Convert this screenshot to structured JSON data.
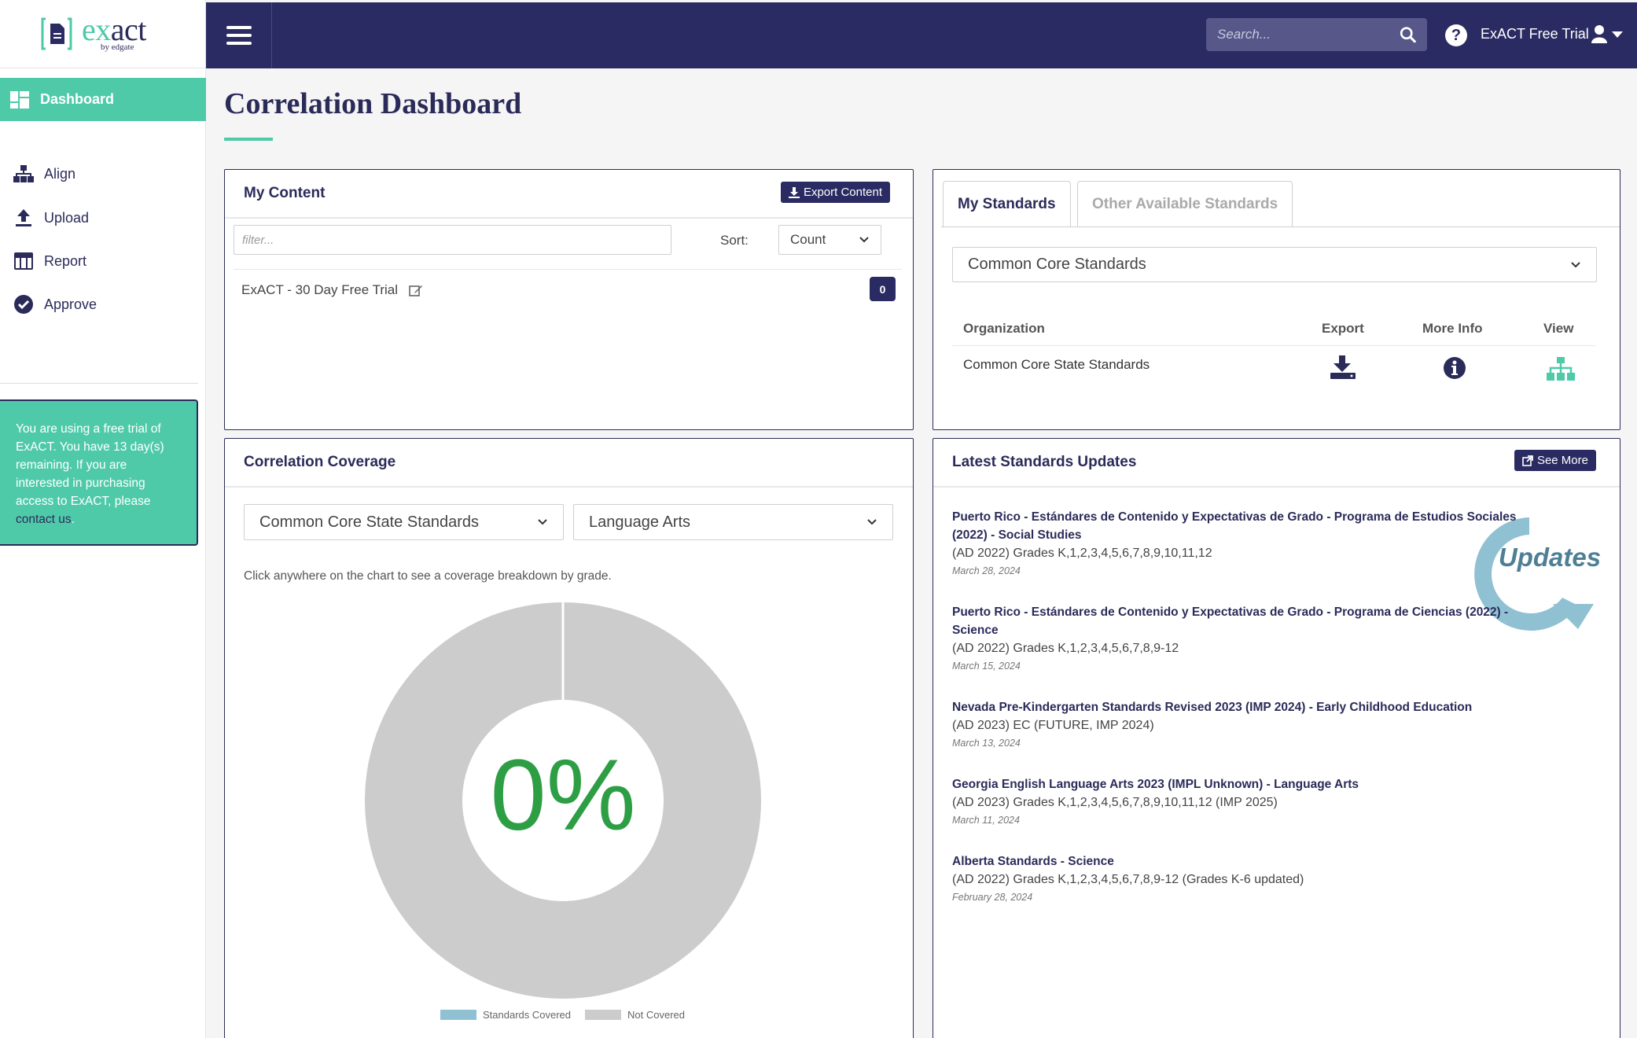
{
  "brand": {
    "logo_main": "exact",
    "logo_sub": "by edgate",
    "accent": "#4fcaa9",
    "navy": "#2b2b63"
  },
  "header": {
    "search_placeholder": "Search...",
    "user_name": "ExACT Free Trial"
  },
  "sidebar": {
    "items": [
      {
        "label": "Dashboard",
        "icon": "dashboard-icon",
        "active": true
      },
      {
        "label": "Align",
        "icon": "sitemap-icon"
      },
      {
        "label": "Upload",
        "icon": "upload-icon"
      },
      {
        "label": "Report",
        "icon": "table-icon"
      },
      {
        "label": "Approve",
        "icon": "check-circle-icon"
      }
    ],
    "trial_text": "You are using a free trial of ExACT. You have 13 day(s) remaining. If you are interested in purchasing access to ExACT, please",
    "trial_link": "contact us",
    "trial_end": "."
  },
  "page": {
    "title": "Correlation Dashboard"
  },
  "my_content": {
    "title": "My Content",
    "export_label": "Export Content",
    "filter_placeholder": "filter...",
    "sort_label": "Sort:",
    "sort_value": "Count",
    "item_name": "ExACT - 30 Day Free Trial",
    "item_count": "0"
  },
  "my_standards": {
    "tab_active": "My Standards",
    "tab_other": "Other Available Standards",
    "select_value": "Common Core Standards",
    "columns": [
      "Organization",
      "Export",
      "More Info",
      "View"
    ],
    "row_org": "Common Core State Standards"
  },
  "coverage": {
    "title": "Correlation Coverage",
    "standard_select": "Common Core State Standards",
    "subject_select": "Language Arts",
    "hint": "Click anywhere on the chart to see a coverage breakdown by grade.",
    "percent_label": "0%"
  },
  "chart_data": {
    "type": "pie",
    "labels": [
      "Standards Covered",
      "Not Covered"
    ],
    "values": [
      0,
      100
    ],
    "colors": [
      "#8fc1d3",
      "#cccccc"
    ],
    "center_label": "0%",
    "legend": "bottom"
  },
  "updates": {
    "title": "Latest Standards Updates",
    "see_more_label": "See More",
    "badge_text": "Updates",
    "items": [
      {
        "title": "Puerto Rico - Estándares de Contenido y Expectativas de Grado - Programa de Estudios Sociales (2022) - Social Studies",
        "detail": "(AD 2022) Grades K,1,2,3,4,5,6,7,8,9,10,11,12",
        "date": "March 28, 2024"
      },
      {
        "title": "Puerto Rico - Estándares de Contenido y Expectativas de Grado - Programa de Ciencias (2022) - Science",
        "detail": "(AD 2022) Grades K,1,2,3,4,5,6,7,8,9-12",
        "date": "March 15, 2024"
      },
      {
        "title": "Nevada Pre-Kindergarten Standards Revised 2023 (IMP 2024) - Early Childhood Education",
        "detail": "(AD 2023) EC (FUTURE, IMP 2024)",
        "date": "March 13, 2024"
      },
      {
        "title": "Georgia English Language Arts 2023 (IMPL Unknown) - Language Arts",
        "detail": "(AD 2023) Grades K,1,2,3,4,5,6,7,8,9,10,11,12 (IMP 2025)",
        "date": "March 11, 2024"
      },
      {
        "title": "Alberta Standards - Science",
        "detail": "(AD 2022) Grades K,1,2,3,4,5,6,7,8,9-12 (Grades K-6 updated)",
        "date": "February 28, 2024"
      }
    ]
  }
}
